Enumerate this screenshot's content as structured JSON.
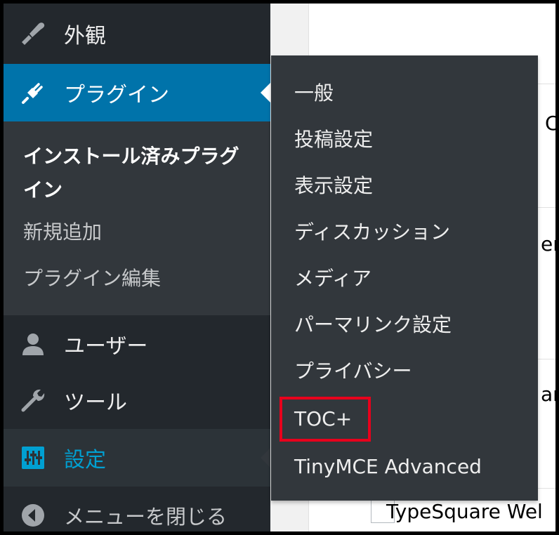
{
  "sidebar": {
    "appearance": {
      "label": "外観",
      "icon": "paintbrush-icon"
    },
    "plugins": {
      "label": "プラグイン",
      "icon": "plugin-icon"
    },
    "plugins_submenu": [
      {
        "label": "インストール済みプラグイン",
        "current": true
      },
      {
        "label": "新規追加",
        "current": false
      },
      {
        "label": "プラグイン編集",
        "current": false
      }
    ],
    "users": {
      "label": "ユーザー",
      "icon": "user-icon"
    },
    "tools": {
      "label": "ツール",
      "icon": "wrench-icon"
    },
    "settings": {
      "label": "設定",
      "icon": "settings-sliders-icon"
    },
    "collapse": {
      "label": "メニューを閉じる",
      "icon": "collapse-arrow-icon"
    }
  },
  "settings_flyout": {
    "items": [
      "一般",
      "投稿設定",
      "表示設定",
      "ディスカッション",
      "メディア",
      "パーマリンク設定",
      "プライバシー",
      "TOC+",
      "TinyMCE Advanced"
    ],
    "highlighted_item": "TOC+",
    "highlight_color": "#e8001c"
  },
  "background_content": {
    "fragments": [
      "C",
      "er",
      "ar",
      "TypeSquare Wel"
    ]
  },
  "colors": {
    "sidebar_bg": "#23282d",
    "submenu_bg": "#32373c",
    "active_bg": "#0073aa",
    "settings_accent": "#00a0d2"
  }
}
